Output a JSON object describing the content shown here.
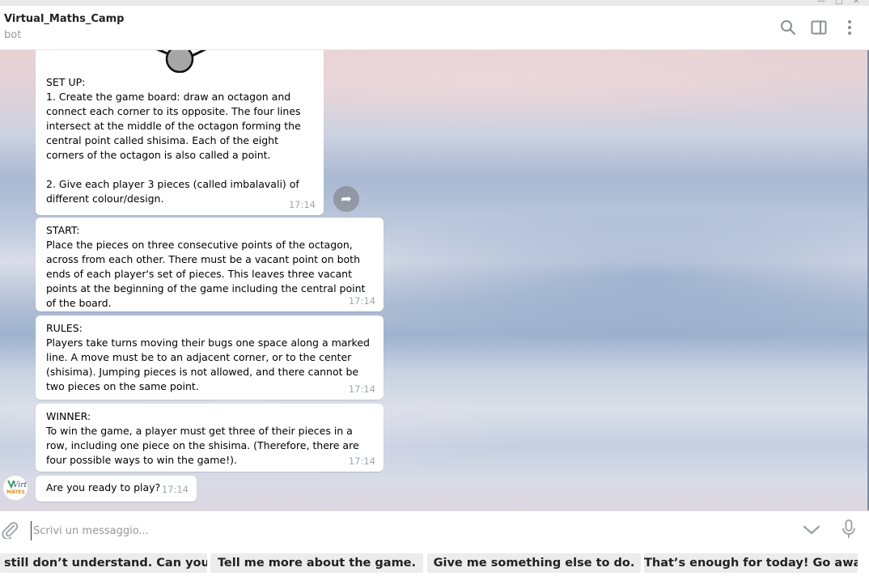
{
  "header": {
    "title": "Virtual_Maths_Camp",
    "subtitle": "bot"
  },
  "messages": [
    {
      "text": "SET UP:\n1. Create the game board: draw an octagon and connect each corner to its opposite. The four lines intersect at the middle of the octagon forming the central point called shisima. Each of the eight corners of the octagon is also called a point.\n\n2. Give each player 3 pieces (called imbalavali) of different colour/design.",
      "time": "17:14"
    },
    {
      "text": "START:\nPlace the pieces on three consecutive points of the octagon, across from each other. There must be a vacant point on both ends of each player's set of pieces. This leaves three vacant points at the beginning of the game including the central point of the board.",
      "time": "17:14"
    },
    {
      "text": "RULES:\nPlayers take turns moving their bugs one space along a marked line. A move must be to an adjacent corner, or to the center (shisima). Jumping pieces is not allowed, and there cannot be two pieces on the same point.",
      "time": "17:14"
    },
    {
      "text": "WINNER:\nTo win the game, a player must get three of their pieces in a row, including one piece on the shisima. (Therefore, there are four possible ways to win the game!).",
      "time": "17:14"
    },
    {
      "text": "Are you ready to play?",
      "time": "17:14"
    }
  ],
  "avatar_logo": {
    "line1": "Virt",
    "line2": "MATES"
  },
  "input": {
    "placeholder": "Scrivi un messaggio...",
    "value": ""
  },
  "keyboard": {
    "buttons": [
      "still don’t understand. Can you g...",
      "Tell me more about the game.",
      "Give me something else to do.",
      "That’s enough for today! Go away!"
    ]
  },
  "icons": {
    "search": "search-icon",
    "sidebar": "sidebar-toggle-icon",
    "more": "more-vertical-icon",
    "forward": "forward-icon",
    "attach": "paperclip-icon",
    "keyboard_toggle": "chevron-down-icon",
    "mic": "microphone-icon"
  },
  "colors": {
    "bubble": "#ffffff",
    "time": "#a0a7ad",
    "keyboard_button": "#ececec"
  }
}
